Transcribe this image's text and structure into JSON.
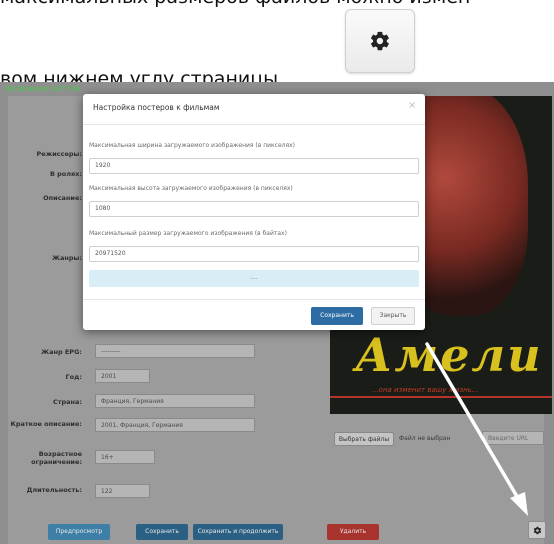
{
  "instructions": {
    "line1": "максимальных размеров файлов можно измен",
    "line2": "вом нижнем углу страницы"
  },
  "timebar": "00:16  всего 13:??:16",
  "form": {
    "labels": {
      "directors": "Режиссеры:",
      "cast": "В ролях:",
      "description": "Описание:",
      "genres": "Жанры:",
      "genre_epg": "Жанр EPG:",
      "year": "Год:",
      "country": "Страна:",
      "short_description": "Краткое описание:",
      "age_limit": "Возрастное ограничение:",
      "duration": "Длительность:"
    },
    "values": {
      "genre_epg": "---------",
      "year": "2001",
      "country": "Франция, Германия",
      "short_description": "2001, Франция, Германия",
      "age_limit": "16+",
      "duration": "122"
    },
    "file_button": "Выбрать файлы",
    "file_status": "Файл не выбран",
    "url_placeholder": "Введите URL",
    "buttons": {
      "preview": "Предпросмотр",
      "save": "Сохранить",
      "save_continue": "Сохранить и продолжить",
      "delete": "Удалить"
    }
  },
  "poster": {
    "title": "Амели",
    "subtitle": "...она изменит вашу жизнь..."
  },
  "modal": {
    "title": "Настройка постеров к фильмам",
    "close_glyph": "×",
    "fields": [
      {
        "label": "Максимальная ширина загружаемого изображения (в пикселях)",
        "value": "1920"
      },
      {
        "label": "Максимальная высота загружаемого изображения (в пикселях)",
        "value": "1080"
      },
      {
        "label": "Максимальный размер загружаемого изображения (в байтах)",
        "value": "20971520"
      }
    ],
    "bar_text": "...",
    "save_label": "Сохранить",
    "close_label": "Закрыть"
  },
  "icons": {
    "gear": "gear-icon",
    "arrow": "arrow-pointer"
  },
  "colors": {
    "primary": "#2e6da4",
    "danger": "#c9302c",
    "timebar": "#3bd63b"
  }
}
